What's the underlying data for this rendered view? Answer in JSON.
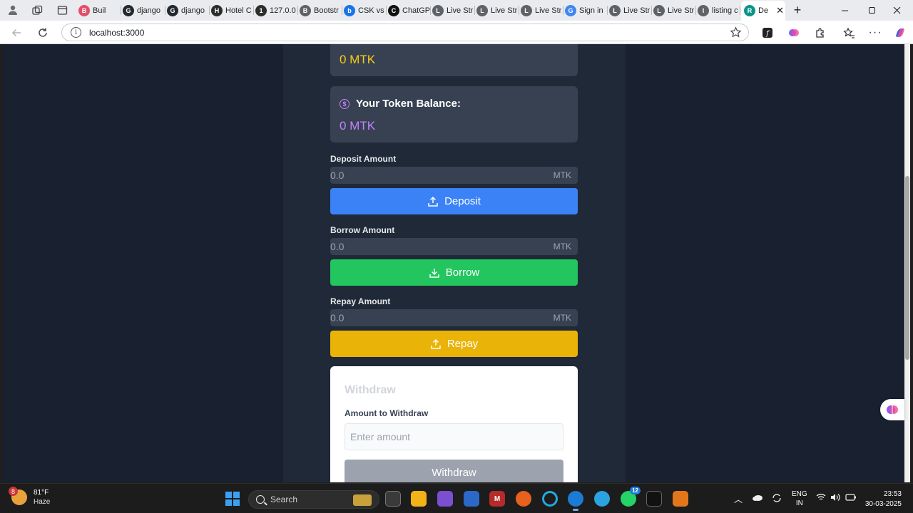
{
  "browser": {
    "tabs": [
      {
        "title": "Buil",
        "color": "#e44d6a",
        "glyph": "B"
      },
      {
        "title": "django",
        "color": "#24292f",
        "glyph": "G"
      },
      {
        "title": "django",
        "color": "#24292f",
        "glyph": "G"
      },
      {
        "title": "Hotel C",
        "color": "#2d2d2d",
        "glyph": "H"
      },
      {
        "title": "127.0.0",
        "color": "#2d2d2d",
        "glyph": "1"
      },
      {
        "title": "Bootstr",
        "color": "#5f6368",
        "glyph": "B"
      },
      {
        "title": "CSK vs",
        "color": "#1a73e8",
        "glyph": "b"
      },
      {
        "title": "ChatGP",
        "color": "#111111",
        "glyph": "C"
      },
      {
        "title": "Live Str",
        "color": "#5f6368",
        "glyph": "L"
      },
      {
        "title": "Live Str",
        "color": "#5f6368",
        "glyph": "L"
      },
      {
        "title": "Live Str",
        "color": "#5f6368",
        "glyph": "L"
      },
      {
        "title": "Sign in",
        "color": "#4285f4",
        "glyph": "G"
      },
      {
        "title": "Live Str",
        "color": "#5f6368",
        "glyph": "L"
      },
      {
        "title": "Live Str",
        "color": "#5f6368",
        "glyph": "L"
      },
      {
        "title": "listing c",
        "color": "#5f6368",
        "glyph": "l"
      }
    ],
    "active_tab": {
      "title": "De",
      "color": "#0d9488",
      "glyph": "R"
    },
    "url": "localhost:3000"
  },
  "app": {
    "top_card_amount": "0 MTK",
    "token_balance": {
      "label": "Your Token Balance:",
      "amount": "0 MTK"
    },
    "deposit": {
      "label": "Deposit Amount",
      "value": "0.0",
      "unit": "MTK",
      "button": "Deposit"
    },
    "borrow": {
      "label": "Borrow Amount",
      "value": "0.0",
      "unit": "MTK",
      "button": "Borrow"
    },
    "repay": {
      "label": "Repay Amount",
      "value": "0.0",
      "unit": "MTK",
      "button": "Repay"
    },
    "withdraw": {
      "title": "Withdraw",
      "label": "Amount to Withdraw",
      "placeholder": "Enter amount",
      "button": "Withdraw"
    }
  },
  "colors": {
    "page_bg": "#192030",
    "panel_bg": "#1f2937",
    "card_bg": "#374151",
    "top_amount": "#facc15",
    "token_amount": "#c084fc",
    "deposit_btn": "#3b82f6",
    "borrow_btn": "#22c55e",
    "repay_btn": "#eab308"
  },
  "taskbar": {
    "weather": {
      "temp": "81°F",
      "condition": "Haze",
      "badge": "8"
    },
    "search_placeholder": "Search",
    "whatsapp_badge": "12",
    "language": {
      "line1": "ENG",
      "line2": "IN"
    },
    "time": "23:53",
    "date": "30-03-2025"
  }
}
